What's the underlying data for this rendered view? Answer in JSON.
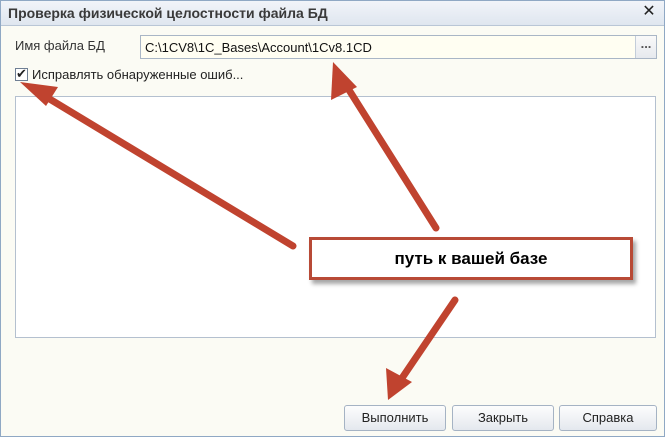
{
  "dialog": {
    "title": "Проверка физической целостности файла БД",
    "close_glyph": "✕"
  },
  "file": {
    "label": "Имя файла БД",
    "value": "C:\\1CV8\\1C_Bases\\Account\\1Cv8.1CD",
    "browse_glyph": "..."
  },
  "fix_errors": {
    "label": "Исправлять обнаруженные ошиб...",
    "checked": true,
    "check_glyph": "✔"
  },
  "buttons": {
    "run": "Выполнить",
    "close": "Закрыть",
    "help": "Справка"
  },
  "annotation": {
    "text": "путь к вашей базе",
    "arrow_color": "#c0432f"
  }
}
